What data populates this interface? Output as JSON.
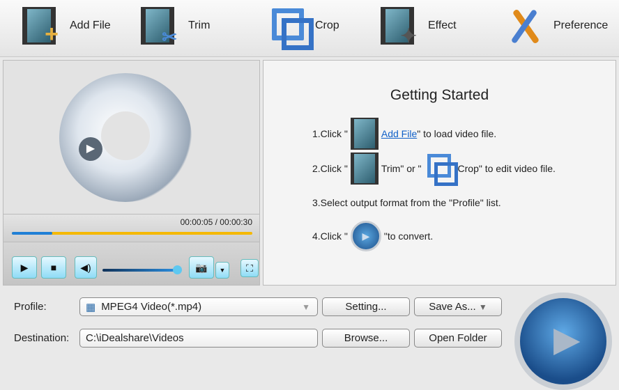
{
  "toolbar": {
    "add_file": "Add File",
    "trim": "Trim",
    "crop": "Crop",
    "effect": "Effect",
    "preference": "Preference"
  },
  "player": {
    "time": "00:00:05 / 00:00:30",
    "progress_percent": 16.7,
    "volume_percent": 100
  },
  "getting_started": {
    "title": "Getting Started",
    "step1_pre": "1.Click \"",
    "step1_link": "Add File",
    "step1_post": "\" to load video file.",
    "step2_pre": "2.Click \"",
    "step2_mid": "Trim\" or \"",
    "step2_post": "Crop\" to edit video file.",
    "step3": "3.Select output format from the \"Profile\" list.",
    "step4_pre": "4.Click \"",
    "step4_post": "\"to convert."
  },
  "bottom": {
    "profile_label": "Profile:",
    "profile_value": "MPEG4 Video(*.mp4)",
    "setting": "Setting...",
    "save_as": "Save As...",
    "destination_label": "Destination:",
    "destination_value": "C:\\iDealshare\\Videos",
    "browse": "Browse...",
    "open_folder": "Open Folder"
  }
}
